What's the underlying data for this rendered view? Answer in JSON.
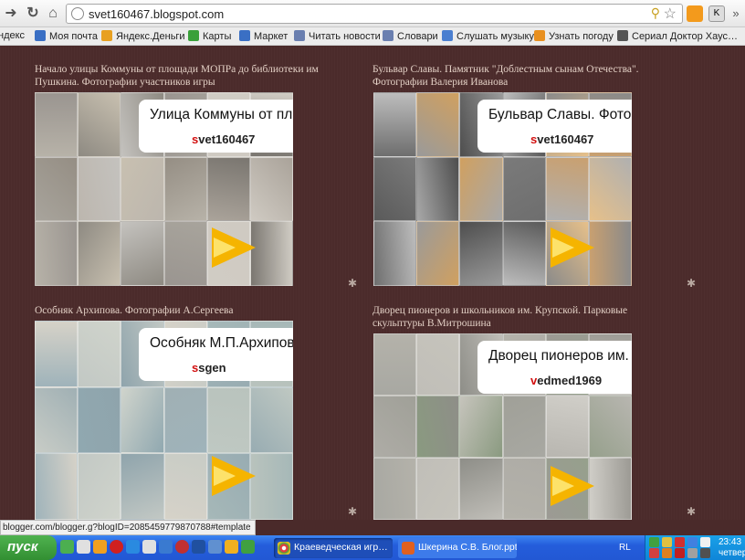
{
  "browser": {
    "url": "svet160467.blogspot.com",
    "bookmarks": [
      {
        "label": "ндекс",
        "color": "#d00"
      },
      {
        "label": "Моя почта",
        "color": "#3a6fc4"
      },
      {
        "label": "Яндекс.Деньги",
        "color": "#e8a020"
      },
      {
        "label": "Карты",
        "color": "#3aa03a"
      },
      {
        "label": "Маркет",
        "color": "#3a6fc4"
      },
      {
        "label": "Читать новости",
        "color": "#6a7fb0"
      },
      {
        "label": "Словари",
        "color": "#6a7fb0"
      },
      {
        "label": "Слушать музыку",
        "color": "#4a7fd0"
      },
      {
        "label": "Узнать погоду",
        "color": "#e89020"
      },
      {
        "label": "Сериал Доктор Хаус…",
        "color": "#555"
      }
    ],
    "more": "»"
  },
  "posts": [
    {
      "caption_line1": "Начало улицы Коммуны от площади МОПРа до библиотеки им",
      "caption_line2": "Пушкина. Фотографии участников игры",
      "card_title": "Улица Коммуны от пл",
      "user_first": "s",
      "user_rest": "vet160467",
      "palette": [
        "#b7b2a8",
        "#8e8a82",
        "#c4c2be",
        "#9a9590",
        "#d0ccc4",
        "#7a7670",
        "#a8a49c",
        "#bcb6ae",
        "#c8c0b0",
        "#958e84",
        "#aaa39a",
        "#cfcac2"
      ]
    },
    {
      "caption_line1": "Бульвар Славы. Памятник \"Доблестным сынам Отечества\".",
      "caption_line2": "Фотографии Валерия Иванова",
      "card_title": "Бульвар Славы. Фото",
      "user_first": "s",
      "user_rest": "vet160467",
      "palette": [
        "#6e6e6e",
        "#9a9a9a",
        "#4e4e4e",
        "#bdbdbd",
        "#8a8a8a",
        "#c9a070",
        "#5a5a5a",
        "#a8a8a8",
        "#d0a060",
        "#7a7a7a",
        "#b0b0b0",
        "#e6c08a"
      ]
    },
    {
      "caption_line1": "Особняк Архипова. Фотографии А.Сергеева",
      "caption_line2": "",
      "card_title": "Особняк М.П.Архипов",
      "user_first": "s",
      "user_rest": "sgen",
      "palette": [
        "#9fb3ba",
        "#c2c8c4",
        "#8fa4ac",
        "#d6d2c8",
        "#a6b8b8",
        "#b9c3bd",
        "#c8ccc6",
        "#90a8b0",
        "#d0d4cc",
        "#a0b0b4",
        "#bfc8c2",
        "#98acb2"
      ]
    },
    {
      "caption_line1": "Дворец пионеров и школьников им. Крупской. Парковые",
      "caption_line2": "скульптуры В.Митрошина",
      "card_title": "Дворец пионеров им.",
      "user_first": "v",
      "user_rest": "edmed1969",
      "palette": [
        "#a8a8a2",
        "#c0beb8",
        "#8e8e88",
        "#b4b2aa",
        "#9c9a94",
        "#d0cec8",
        "#aeaca6",
        "#8a9a80",
        "#c6c4bc",
        "#a0a098",
        "#b8b6b0",
        "#96a08c"
      ]
    }
  ],
  "status_text": "blogger.com/blogger.g?blogID=2085459779870788#template",
  "taskbar": {
    "start_label": "пуск",
    "tasks": [
      {
        "label": "Краеведческая игр…",
        "active": true
      },
      {
        "label": "Шкерина С.В. Блог.ppt",
        "active": false
      }
    ],
    "lang": "RL",
    "time": "23:43",
    "day": "четвер"
  }
}
